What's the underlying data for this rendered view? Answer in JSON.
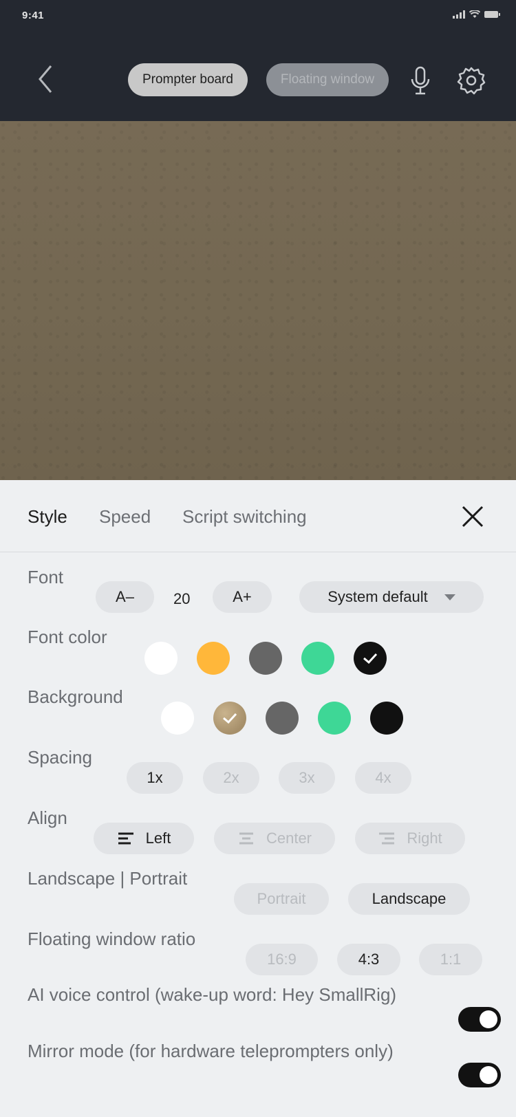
{
  "status": {
    "time": "9:41"
  },
  "header": {
    "board_label": "Prompter board",
    "floating_label": "Floating window"
  },
  "tabs": [
    {
      "label": "Style",
      "active": true
    },
    {
      "label": "Speed",
      "active": false
    },
    {
      "label": "Script switching",
      "active": false
    }
  ],
  "font": {
    "label": "Font",
    "decrease_label": "A–",
    "size_value": "20",
    "increase_label": "A+",
    "family_value": "System default"
  },
  "font_color": {
    "label": "Font color",
    "options": [
      "#ffffff",
      "#ffb73a",
      "#666666",
      "#3ed796",
      "#111111"
    ],
    "selected_index": 4
  },
  "background": {
    "label": "Background",
    "options": [
      "#ffffff",
      "#a68f6a",
      "#666666",
      "#3ed796",
      "#111111"
    ],
    "selected_index": 1
  },
  "spacing": {
    "label": "Spacing",
    "options": [
      "1x",
      "2x",
      "3x",
      "4x"
    ],
    "selected": "1x"
  },
  "align": {
    "label": "Align",
    "options": [
      "Left",
      "Center",
      "Right"
    ],
    "selected": "Left"
  },
  "orientation": {
    "label": "Landscape | Portrait",
    "options": [
      "Portrait",
      "Landscape"
    ],
    "selected": "Landscape"
  },
  "ratio": {
    "label": "Floating window ratio",
    "options": [
      "16:9",
      "4:3",
      "1:1"
    ],
    "selected": "4:3"
  },
  "voice": {
    "label": "AI voice control (wake-up word: Hey SmallRig)",
    "enabled": true
  },
  "mirror": {
    "label": "Mirror mode (for hardware teleprompters only)",
    "enabled": true
  }
}
